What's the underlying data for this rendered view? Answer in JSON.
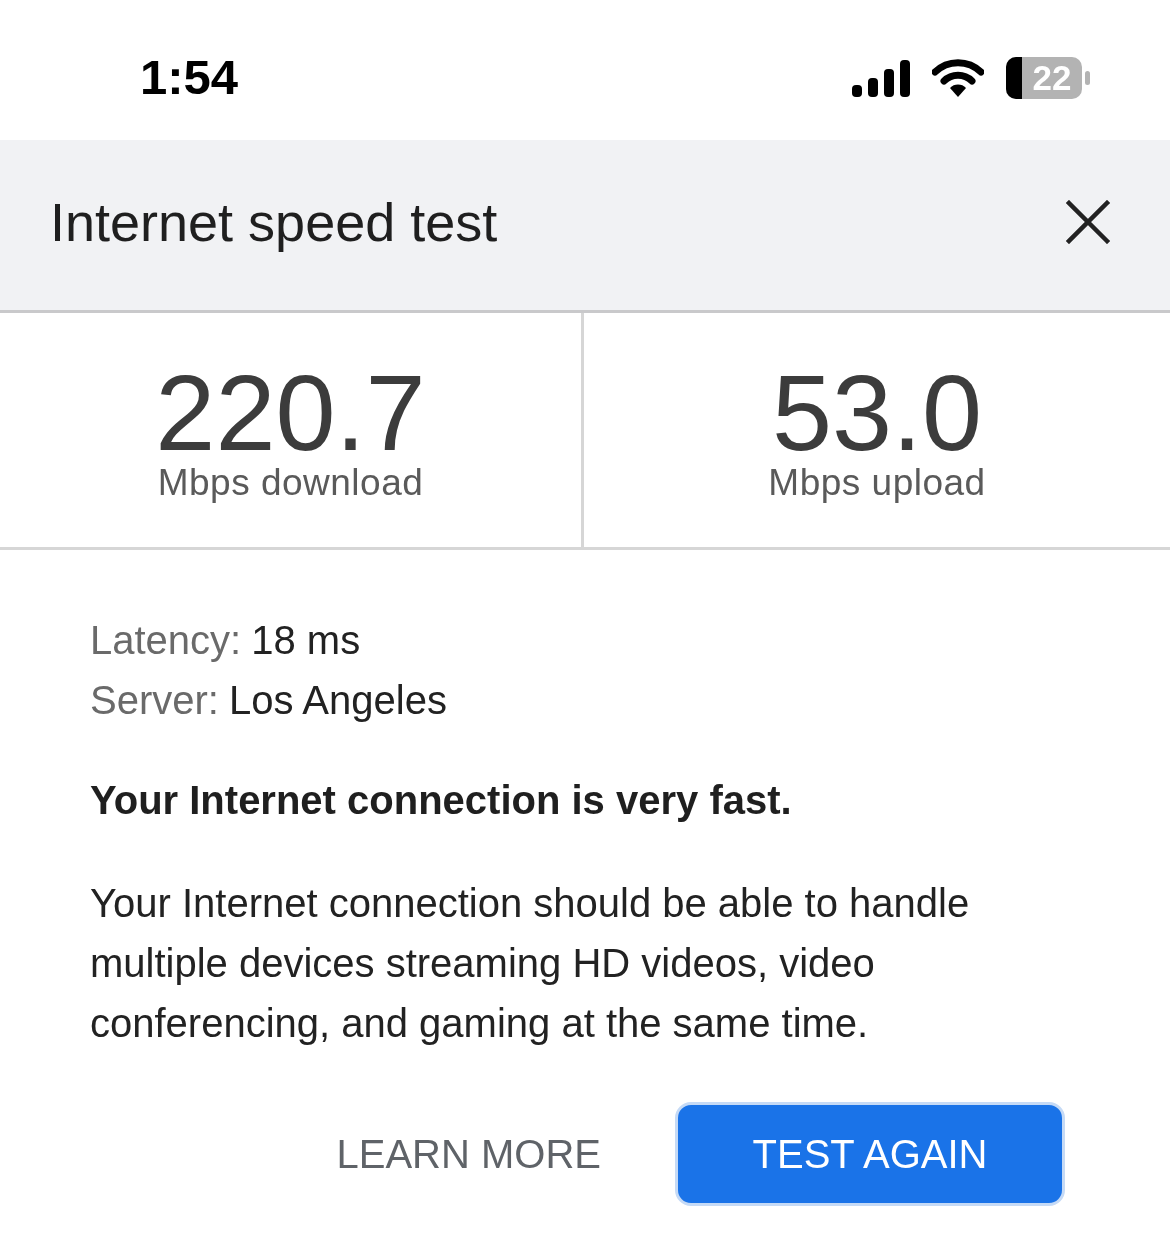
{
  "status_bar": {
    "time": "1:54",
    "battery_text": "22"
  },
  "header": {
    "title": "Internet speed test"
  },
  "results": [
    {
      "value": "220.7",
      "unit": "Mbps download"
    },
    {
      "value": "53.0",
      "unit": "Mbps upload"
    }
  ],
  "details": [
    {
      "label": "Latency:",
      "value": "18 ms"
    },
    {
      "label": "Server:",
      "value": "Los Angeles"
    }
  ],
  "verdict": "Your Internet connection is very fast.",
  "description": "Your Internet connection should be able to handle multiple devices streaming HD videos, video conferencing, and gaming at the same time.",
  "buttons": [
    {
      "label": "LEARN MORE",
      "kind": "text"
    },
    {
      "label": "TEST AGAIN",
      "kind": "primary"
    }
  ]
}
